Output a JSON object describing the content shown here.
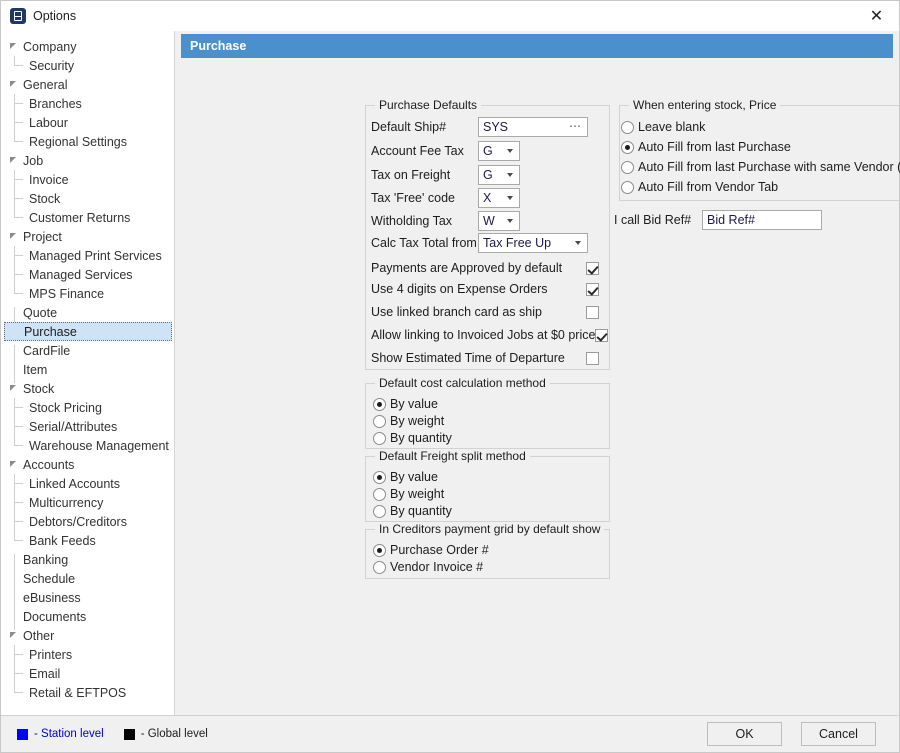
{
  "window": {
    "title": "Options",
    "icon": "app-icon",
    "close_label": "✕"
  },
  "sidebar": {
    "items": [
      {
        "label": "Company",
        "level": 0,
        "expanded": true
      },
      {
        "label": "Security",
        "level": 1,
        "last": true
      },
      {
        "label": "General",
        "level": 0,
        "expanded": true
      },
      {
        "label": "Branches",
        "level": 1,
        "last": false
      },
      {
        "label": "Labour",
        "level": 1,
        "last": false
      },
      {
        "label": "Regional Settings",
        "level": 1,
        "last": true
      },
      {
        "label": "Job",
        "level": 0,
        "expanded": true
      },
      {
        "label": "Invoice",
        "level": 1,
        "last": false
      },
      {
        "label": "Stock",
        "level": 1,
        "last": false
      },
      {
        "label": "Customer Returns",
        "level": 1,
        "last": true
      },
      {
        "label": "Project",
        "level": 0,
        "expanded": true
      },
      {
        "label": "Managed Print Services",
        "level": 1,
        "last": false
      },
      {
        "label": "Managed Services",
        "level": 1,
        "last": false
      },
      {
        "label": "MPS Finance",
        "level": 1,
        "last": true
      },
      {
        "label": "Quote",
        "level": 0,
        "expanded": false
      },
      {
        "label": "Purchase",
        "level": 0,
        "expanded": false,
        "selected": true
      },
      {
        "label": "CardFile",
        "level": 0,
        "expanded": false
      },
      {
        "label": "Item",
        "level": 0,
        "expanded": false
      },
      {
        "label": "Stock",
        "level": 0,
        "expanded": true
      },
      {
        "label": "Stock Pricing",
        "level": 1,
        "last": false
      },
      {
        "label": "Serial/Attributes",
        "level": 1,
        "last": false
      },
      {
        "label": "Warehouse Management",
        "level": 1,
        "last": true
      },
      {
        "label": "Accounts",
        "level": 0,
        "expanded": true
      },
      {
        "label": "Linked Accounts",
        "level": 1,
        "last": false
      },
      {
        "label": "Multicurrency",
        "level": 1,
        "last": false
      },
      {
        "label": "Debtors/Creditors",
        "level": 1,
        "last": false
      },
      {
        "label": "Bank Feeds",
        "level": 1,
        "last": true
      },
      {
        "label": "Banking",
        "level": 0,
        "expanded": false
      },
      {
        "label": "Schedule",
        "level": 0,
        "expanded": false
      },
      {
        "label": "eBusiness",
        "level": 0,
        "expanded": false
      },
      {
        "label": "Documents",
        "level": 0,
        "expanded": false
      },
      {
        "label": "Other",
        "level": 0,
        "expanded": true
      },
      {
        "label": "Printers",
        "level": 1,
        "last": false
      },
      {
        "label": "Email",
        "level": 1,
        "last": false
      },
      {
        "label": "Retail & EFTPOS",
        "level": 1,
        "last": true
      }
    ]
  },
  "page": {
    "header_title": "Purchase"
  },
  "purchase_defaults": {
    "title": "Purchase Defaults",
    "fields": [
      {
        "label": "Default Ship#",
        "value": "SYS",
        "type": "textbox",
        "browse": "⋯"
      },
      {
        "label": "Account Fee Tax",
        "value": "G",
        "type": "combo"
      },
      {
        "label": "Tax on Freight",
        "value": "G",
        "type": "combo"
      },
      {
        "label": "Tax 'Free' code",
        "value": "X",
        "type": "combo"
      },
      {
        "label": "Witholding Tax",
        "value": "W",
        "type": "combo"
      },
      {
        "label": "Calc Tax Total from",
        "value": "Tax Free Up",
        "type": "combo-wide"
      }
    ],
    "checkboxes": [
      {
        "label": "Payments are Approved by default",
        "checked": true
      },
      {
        "label": "Use 4 digits on Expense Orders",
        "checked": true
      },
      {
        "label": "Use linked branch card as ship",
        "checked": false
      },
      {
        "label": "Allow linking to Invoiced Jobs at $0 price",
        "checked": true
      },
      {
        "label": "Show Estimated Time of Departure",
        "checked": false
      }
    ]
  },
  "cost_calc": {
    "title": "Default cost calculation method",
    "options": [
      {
        "label": "By value",
        "selected": true
      },
      {
        "label": "By weight",
        "selected": false
      },
      {
        "label": "By quantity",
        "selected": false
      }
    ]
  },
  "freight_split": {
    "title": "Default Freight split method",
    "options": [
      {
        "label": "By value",
        "selected": true
      },
      {
        "label": "By weight",
        "selected": false
      },
      {
        "label": "By quantity",
        "selected": false
      }
    ]
  },
  "creditors_grid": {
    "title": "In Creditors payment grid by default show",
    "options": [
      {
        "label": "Purchase Order #",
        "selected": true
      },
      {
        "label": "Vendor Invoice #",
        "selected": false
      }
    ]
  },
  "stock_price": {
    "title": "When entering stock, Price",
    "options": [
      {
        "label": "Leave blank",
        "selected": false
      },
      {
        "label": "Auto Fill from last Purchase",
        "selected": true
      },
      {
        "label": "Auto Fill from last Purchase with same Vendor (From#)",
        "selected": false
      },
      {
        "label": "Auto Fill from Vendor Tab",
        "selected": false
      }
    ]
  },
  "bid_ref": {
    "label": "I call Bid Ref#",
    "value": "Bid Ref#"
  },
  "footer": {
    "legend": [
      {
        "text": "- Station level",
        "color": "#0000ff"
      },
      {
        "text": "- Global level",
        "color": "#000000"
      }
    ],
    "ok_label": "OK",
    "cancel_label": "Cancel"
  }
}
